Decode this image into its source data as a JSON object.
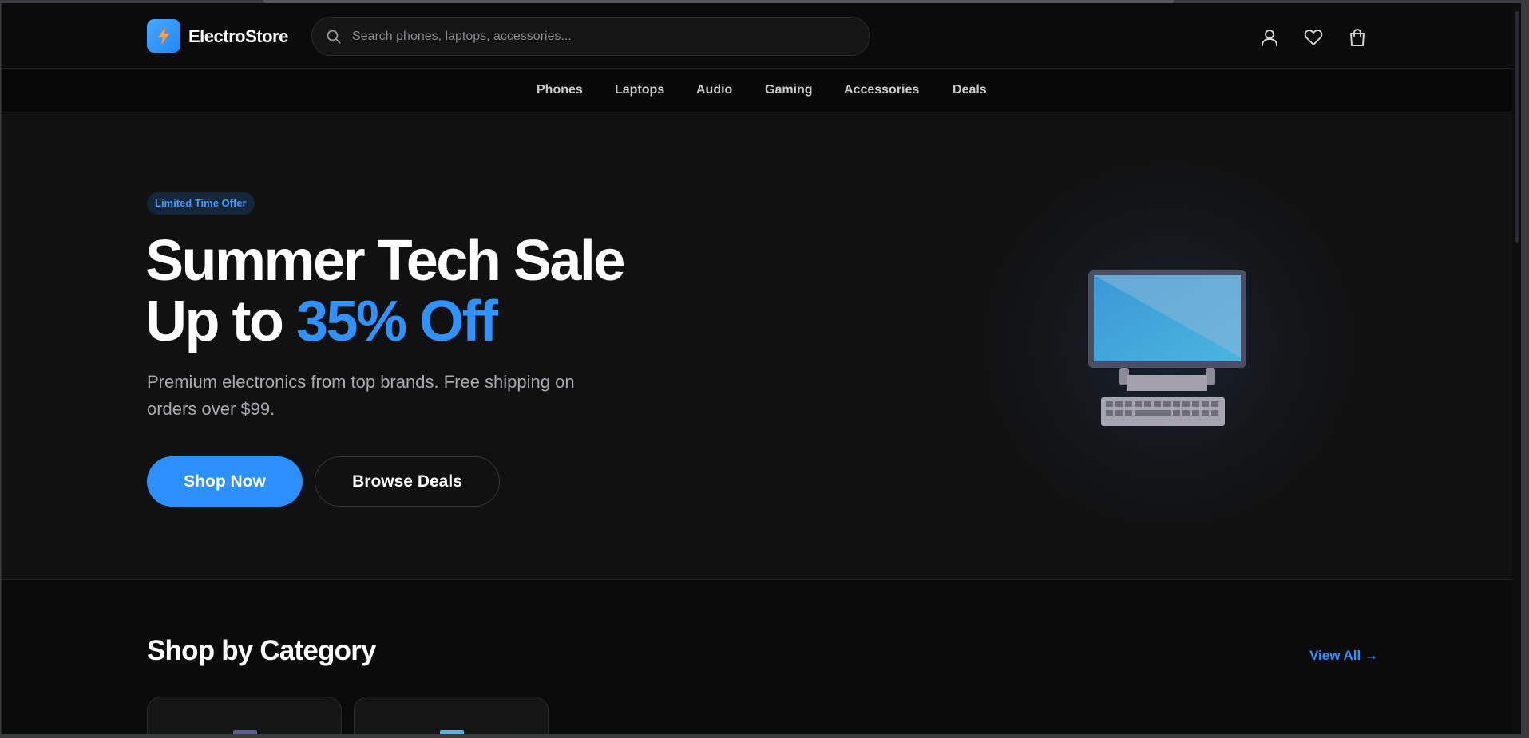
{
  "header": {
    "logo_text": "ElectroStore",
    "search_placeholder": "Search phones, laptops, accessories...",
    "icons": [
      "user-icon",
      "heart-icon",
      "shopping-bag-icon"
    ]
  },
  "nav": {
    "items": [
      "Phones",
      "Laptops",
      "Audio",
      "Gaming",
      "Accessories",
      "Deals"
    ]
  },
  "hero": {
    "badge": "Limited Time Offer",
    "headline_line1": "Summer Tech Sale",
    "headline_line2_prefix": "Up to ",
    "headline_line2_accent": "35% Off",
    "subtext": "Premium electronics from top brands. Free shipping on orders over $99.",
    "primary_button": "Shop Now",
    "secondary_button": "Browse Deals"
  },
  "categories": {
    "title": "Shop by Category",
    "view_all": "View All →"
  },
  "colors": {
    "accent": "#2c91ff",
    "background": "#0b0b0c",
    "hero_background": "#111112"
  }
}
